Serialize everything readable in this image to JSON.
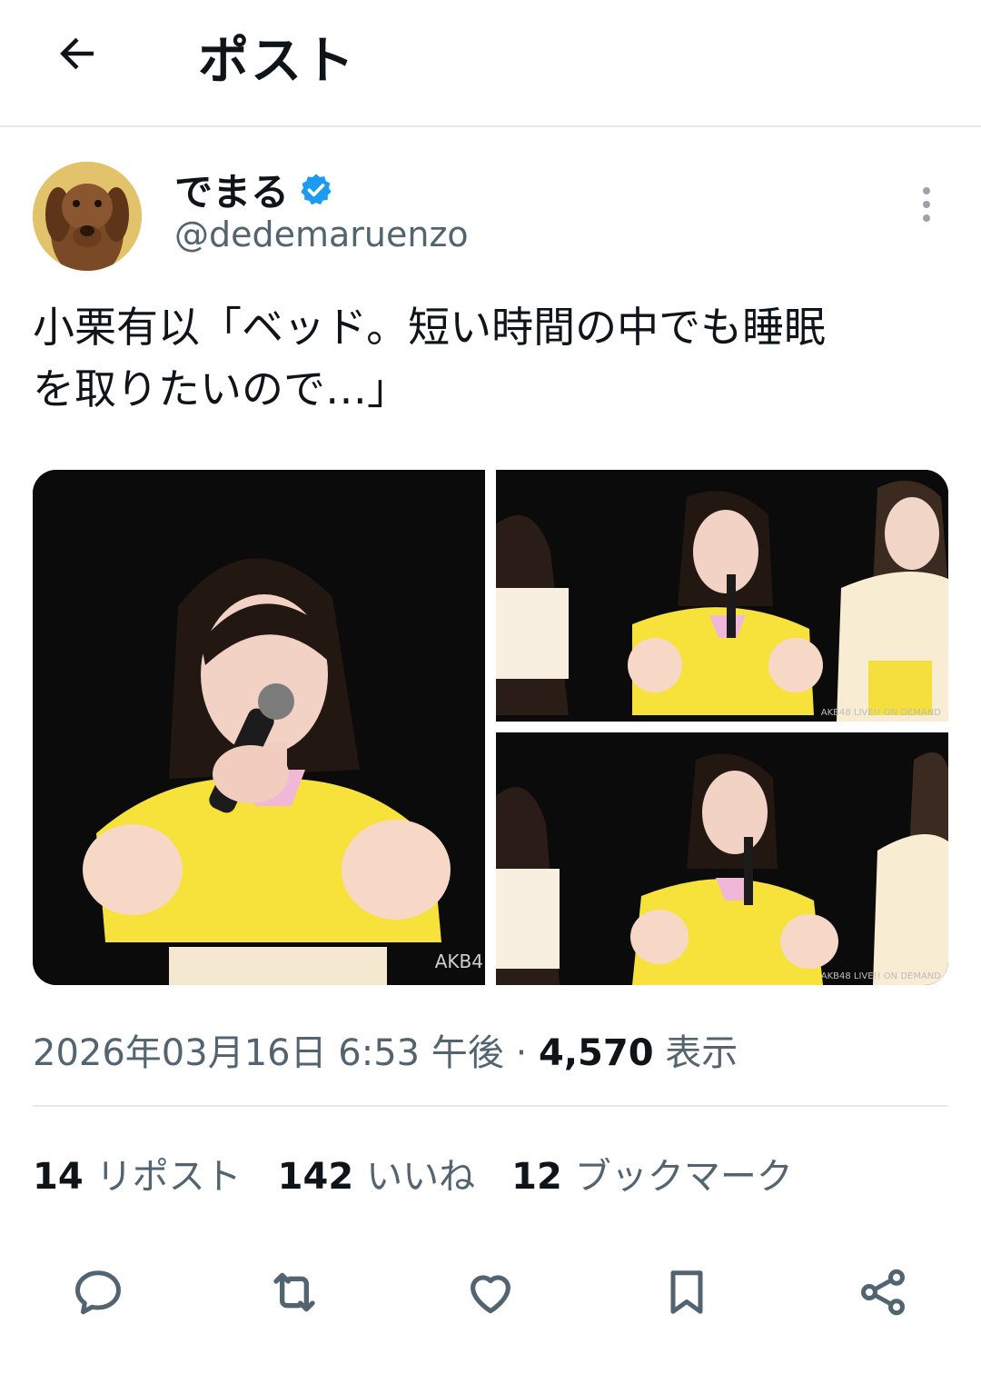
{
  "header": {
    "title": "ポスト"
  },
  "author": {
    "display_name": "でまる",
    "handle": "@dedemaruenzo"
  },
  "tweet": {
    "text": "小栗有以「ベッド。短い時間の中でも睡眠\nを取りたいので…」"
  },
  "media": {
    "watermark_main": "AKB4",
    "watermark_small": "AKB48 LIVE!! ON DEMAND"
  },
  "meta": {
    "datetime": "2026年03月16日 6:53 午後",
    "separator": " · ",
    "views_count": "4,570",
    "views_label": "表示"
  },
  "stats": {
    "reposts_count": "14",
    "reposts_label": "リポスト",
    "likes_count": "142",
    "likes_label": "いいね",
    "bookmarks_count": "12",
    "bookmarks_label": "ブックマーク"
  },
  "icons": [
    "back-arrow-icon",
    "verified-badge-icon",
    "more-options-icon",
    "reply-icon",
    "retweet-icon",
    "like-icon",
    "bookmark-icon",
    "share-icon"
  ],
  "colors": {
    "verified": "#1d9bf0",
    "secondary_text": "#536471",
    "divider": "#e6e9eb"
  }
}
